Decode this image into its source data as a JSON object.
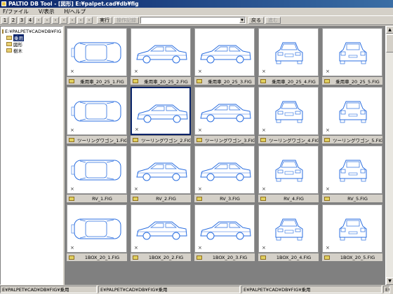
{
  "window": {
    "title": "PALTIO DB Tool - [図形] E:¥palpet.cad¥db¥fig"
  },
  "menu": {
    "items": [
      "F/ファイル",
      "V/表示",
      "H/ヘルプ"
    ]
  },
  "toolbar": {
    "number_buttons": [
      "1",
      "2",
      "3",
      "4",
      "-",
      "-",
      "-",
      "-",
      "-",
      "-",
      "-"
    ],
    "run_label": "実行",
    "history_label": "操作記録",
    "back_label": "戻る",
    "forward_label": "進む"
  },
  "tree": {
    "root": "E:¥PALPET¥CAD¥DB¥FIG",
    "children": [
      "乗用",
      "図形",
      "樹木"
    ],
    "selected_index": 0
  },
  "grid": {
    "rows": [
      [
        "乗用車_20_25_1.FIG",
        "乗用車_20_25_2.FIG",
        "乗用車_20_25_3.FIG",
        "乗用車_20_25_4.FIG",
        "乗用車_20_25_5.FIG"
      ],
      [
        "ツーリングワゴン_1.FIG",
        "ツーリングワゴン_2.FIG",
        "ツーリングワゴン_3.FIG",
        "ツーリングワゴン_4.FIG",
        "ツーリングワゴン_5.FIG"
      ],
      [
        "RV_1.FIG",
        "RV_2.FIG",
        "RV_3.FIG",
        "RV_4.FIG",
        "RV_5.FIG"
      ],
      [
        "1BOX_20_1.FIG",
        "1BOX_20_2.FIG",
        "1BOX_20_3.FIG",
        "1BOX_20_4.FIG",
        "1BOX_20_5.FIG"
      ]
    ],
    "views": [
      "top-view",
      "side-view",
      "side-view",
      "front-view",
      "rear-view"
    ],
    "selected": {
      "row": 1,
      "col": 1
    },
    "line_color": "#2a6ee0"
  },
  "statusbar": {
    "panes": [
      "E¥PALPET¥CAD¥DB¥FIG¥乗用",
      "E¥PALPET¥CAD¥DB¥FIG¥乗用",
      "E¥PALPET¥CAD¥DB¥FIG¥乗用",
      "E¥PALPET¥CAD¥DB¥FIG¥乗用"
    ]
  }
}
